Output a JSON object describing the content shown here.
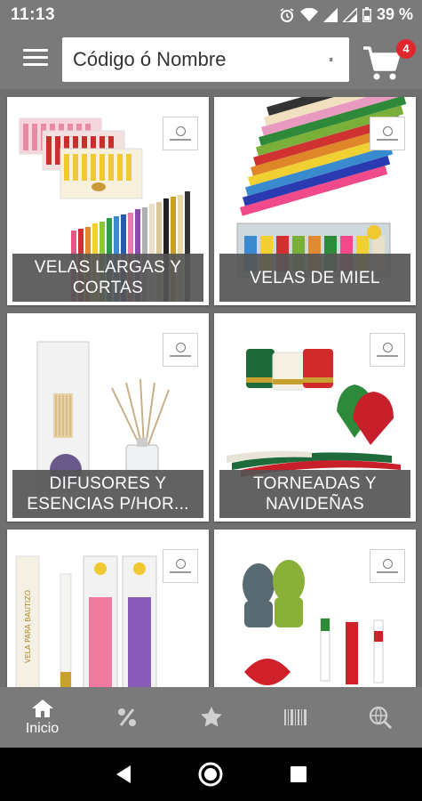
{
  "status_bar": {
    "time": "11:13",
    "battery_percent": "39 %",
    "icons": [
      "alarm-icon",
      "wifi-icon",
      "signal-icon",
      "signal-icon",
      "battery-icon"
    ]
  },
  "app_bar": {
    "menu_icon": "hamburger-menu-icon",
    "search_placeholder": "Código ó Nombre",
    "filter_icon": "sliders-filter-icon",
    "cart_icon": "shopping-cart-icon",
    "cart_count": "4",
    "cart_badge_color": "#e0262e"
  },
  "categories": [
    {
      "label": "VELAS LARGAS Y CORTAS"
    },
    {
      "label": "VELAS DE MIEL"
    },
    {
      "label": "DIFUSORES Y ESENCIAS P/HOR..."
    },
    {
      "label": "TORNEADAS Y NAVIDEÑAS"
    },
    {
      "label": ""
    },
    {
      "label": ""
    }
  ],
  "bottom_nav": [
    {
      "label": "Inicio",
      "icon": "home-icon",
      "active": true
    },
    {
      "label": "",
      "icon": "percent-icon",
      "active": false
    },
    {
      "label": "",
      "icon": "star-icon",
      "active": false
    },
    {
      "label": "",
      "icon": "barcode-icon",
      "active": false
    },
    {
      "label": "",
      "icon": "globe-search-icon",
      "active": false
    }
  ],
  "system_nav": [
    "back-icon",
    "home-circle-icon",
    "recents-icon"
  ]
}
